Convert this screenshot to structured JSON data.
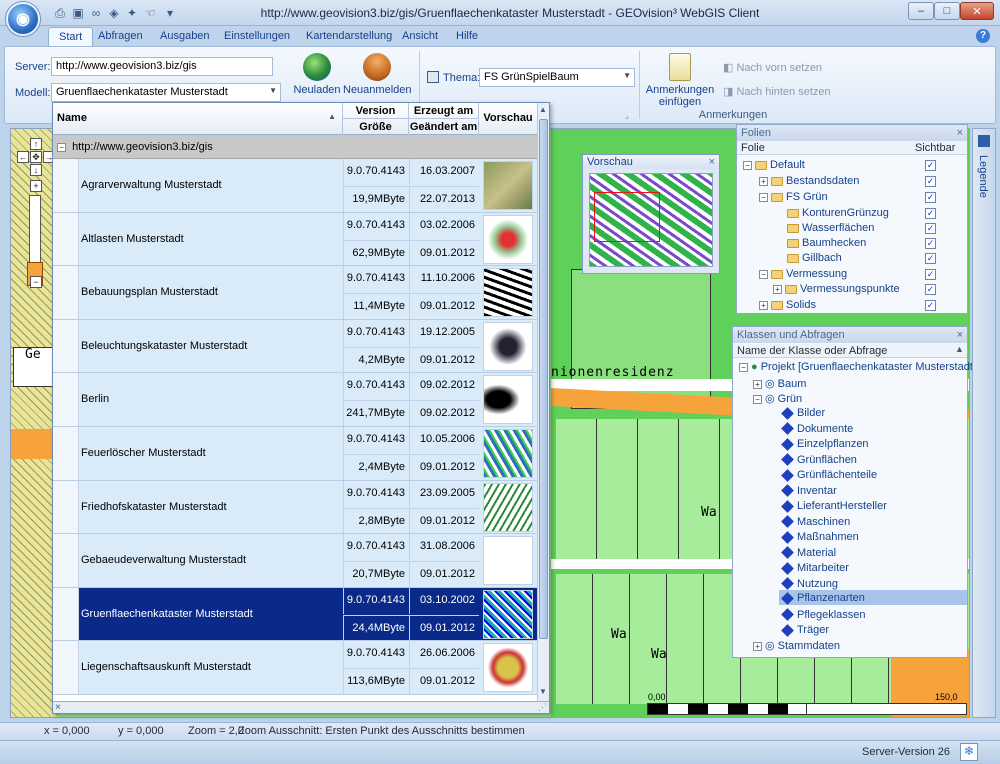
{
  "window": {
    "title": "http://www.geovision3.biz/gis/Gruenflaechenkataster Musterstadt - GEOvision³ WebGIS Client"
  },
  "tabs": [
    "Start",
    "Abfragen",
    "Ausgaben",
    "Einstellungen",
    "Kartendarstellung",
    "Ansicht",
    "Hilfe"
  ],
  "ribbon": {
    "server_label": "Server:",
    "server_value": "http://www.geovision3.biz/gis",
    "model_label": "Modell:",
    "model_value": "Gruenflaechenkataster Musterstadt",
    "reload_label": "Neuladen",
    "relogin_label": "Neuanmelden",
    "theme_label": "Thema:",
    "theme_value": "FS GrünSpielBaum",
    "annot_insert_label_1": "Anmerkungen",
    "annot_insert_label_2": "einfügen",
    "bring_front_label": "Nach vorn setzen",
    "send_back_label": "Nach hinten setzen",
    "annot_group_label": "Anmerkungen"
  },
  "grid": {
    "col_name": "Name",
    "col_version": "Version",
    "col_size": "Größe",
    "col_created": "Erzeugt am",
    "col_changed": "Geändert am",
    "col_preview": "Vorschau",
    "group": "http://www.geovision3.biz/gis",
    "rows": [
      {
        "name": "Agrarverwaltung Musterstadt",
        "version": "9.0.70.4143",
        "size": "19,9MByte",
        "created": "16.03.2007",
        "changed": "22.07.2013"
      },
      {
        "name": "Altlasten Musterstadt",
        "version": "9.0.70.4143",
        "size": "62,9MByte",
        "created": "03.02.2006",
        "changed": "09.01.2012"
      },
      {
        "name": "Bebauungsplan Musterstadt",
        "version": "9.0.70.4143",
        "size": "11,4MByte",
        "created": "11.10.2006",
        "changed": "09.01.2012"
      },
      {
        "name": "Beleuchtungskataster Musterstadt",
        "version": "9.0.70.4143",
        "size": "4,2MByte",
        "created": "19.12.2005",
        "changed": "09.01.2012"
      },
      {
        "name": "Berlin",
        "version": "9.0.70.4143",
        "size": "241,7MByte",
        "created": "09.02.2012",
        "changed": "09.02.2012"
      },
      {
        "name": "Feuerlöscher Musterstadt",
        "version": "9.0.70.4143",
        "size": "2,4MByte",
        "created": "10.05.2006",
        "changed": "09.01.2012"
      },
      {
        "name": "Friedhofskataster Musterstadt",
        "version": "9.0.70.4143",
        "size": "2,8MByte",
        "created": "23.09.2005",
        "changed": "09.01.2012"
      },
      {
        "name": "Gebaeudeverwaltung Musterstadt",
        "version": "9.0.70.4143",
        "size": "20,7MByte",
        "created": "31.08.2006",
        "changed": "09.01.2012"
      },
      {
        "name": "Gruenflaechenkataster Musterstadt",
        "version": "9.0.70.4143",
        "size": "24,4MByte",
        "created": "03.10.2002",
        "changed": "09.01.2012"
      },
      {
        "name": "Liegenschaftsauskunft Musterstadt",
        "version": "9.0.70.4143",
        "size": "113,6MByte",
        "created": "26.06.2006",
        "changed": "09.01.2012"
      }
    ]
  },
  "preview": {
    "title": "Vorschau"
  },
  "layers": {
    "title": "Folien",
    "col_layer": "Folie",
    "col_visible": "Sichtbar",
    "items": [
      "Default",
      "Bestandsdaten",
      "FS Grün",
      "KonturenGrünzug",
      "Wasserflächen",
      "Baumhecken",
      "Gillbach",
      "Vermessung",
      "Vermessungspunkte",
      "Solids"
    ]
  },
  "classes": {
    "title": "Klassen und Abfragen",
    "col_name": "Name der Klasse oder Abfrage",
    "project": "Projekt [Gruenflaechenkataster Musterstadt]",
    "baum": "Baum",
    "gruen": "Grün",
    "items": [
      "Bilder",
      "Dokumente",
      "Einzelpflanzen",
      "Grünflächen",
      "Grünflächenteile",
      "Inventar",
      "LieferantHersteller",
      "Maschinen",
      "Maßnahmen",
      "Material",
      "Mitarbeiter",
      "Nutzung",
      "Pflanzenarten",
      "Pflegeklassen",
      "Träger"
    ],
    "stammdaten": "Stammdaten"
  },
  "map_text": {
    "residenz": "nionenresidenz",
    "ge": "Ge",
    "wa1": "Wa",
    "wa2": "Wa",
    "wa3": "Wa",
    "scale_0": "0,00",
    "scale_1": "150,0"
  },
  "status": {
    "x": "x = 0,000",
    "y": "y = 0,000",
    "zoom": "Zoom = 2,0",
    "message": "Zoom Ausschnitt: Ersten Punkt des Ausschnitts bestimmen",
    "server_version": "Server-Version 26"
  },
  "legend_tab": "Legende"
}
